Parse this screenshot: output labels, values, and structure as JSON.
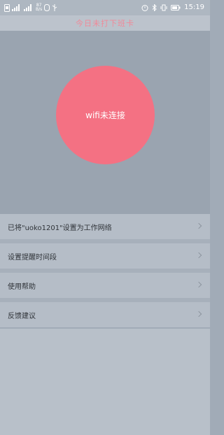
{
  "status_bar": {
    "net_speed_value": "87",
    "net_speed_unit": "B/s",
    "time": "15:19"
  },
  "header": {
    "title": "今日未打下班卡"
  },
  "wifi": {
    "status_label": "wifi未连接"
  },
  "menu": {
    "items": [
      {
        "label": "已将\"uoko1201\"设置为工作网络"
      },
      {
        "label": "设置提醒时间段"
      },
      {
        "label": "使用帮助"
      },
      {
        "label": "反馈建议"
      }
    ]
  },
  "colors": {
    "accent": "#f47183",
    "header_text": "#f08a99",
    "overlay_bg": "#a1abb7"
  }
}
